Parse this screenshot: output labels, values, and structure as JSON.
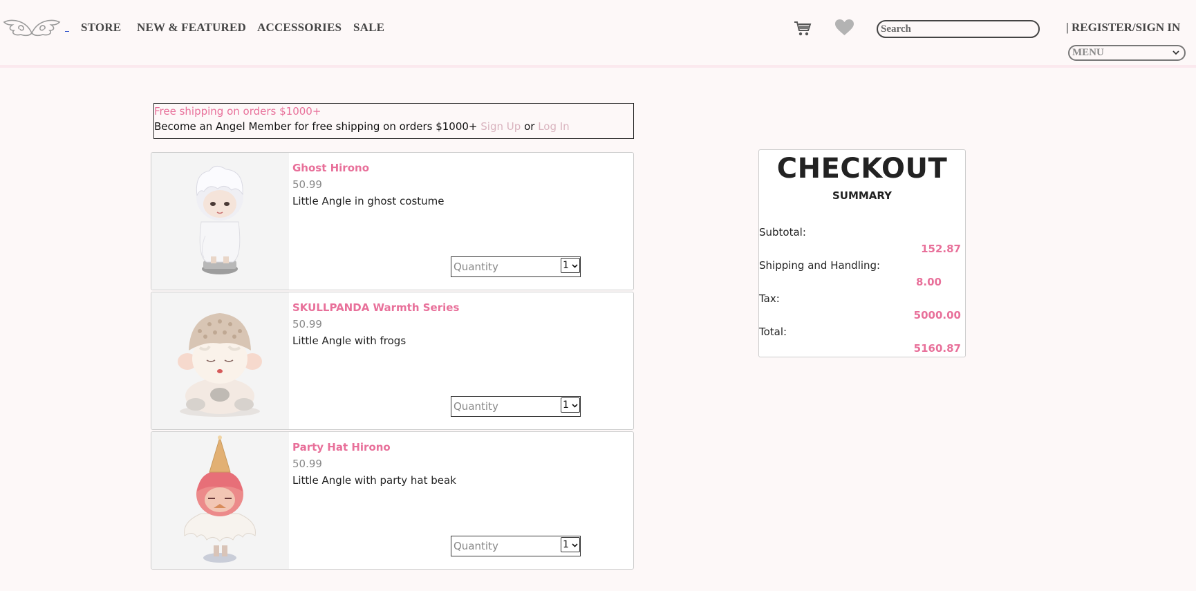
{
  "header": {
    "nav": [
      {
        "label": "STORE"
      },
      {
        "label": "NEW & FEATURED"
      },
      {
        "label": "ACCESSORIES"
      },
      {
        "label": "SALE"
      }
    ],
    "search_placeholder": "Search",
    "register_label": "| REGISTER/SIGN IN",
    "menu_label": "MENU"
  },
  "banner": {
    "promo": "Free shipping on orders $1000+",
    "message": "Become an Angel Member for free shipping on orders $1000+",
    "signup": "Sign Up",
    "or": "or",
    "login": "Log In"
  },
  "cart": {
    "quantity_placeholder": "Quantity",
    "items": [
      {
        "name": "Ghost Hirono",
        "price": "50.99",
        "description": "Little Angle in ghost costume",
        "qty": "1"
      },
      {
        "name": "SKULLPANDA Warmth Series",
        "price": "50.99",
        "description": "Little Angle with frogs",
        "qty": "1"
      },
      {
        "name": "Party Hat Hirono",
        "price": "50.99",
        "description": "Little Angle with party hat beak",
        "qty": "1"
      }
    ]
  },
  "checkout": {
    "title": "CHECKOUT",
    "subtitle": "SUMMARY",
    "rows": [
      {
        "label": "Subtotal:",
        "value": "152.87"
      },
      {
        "label": "Shipping and Handling:",
        "value": "8.00"
      },
      {
        "label": "Tax:",
        "value": "5000.00"
      },
      {
        "label": "Total:",
        "value": "5160.87"
      }
    ]
  },
  "colors": {
    "accent": "#e8709a",
    "background": "#fdf8f8",
    "muted_link": "#d9b3be"
  },
  "icons": [
    "angel-wings-logo-icon",
    "cart-icon",
    "heart-icon",
    "chevron-down-icon"
  ]
}
